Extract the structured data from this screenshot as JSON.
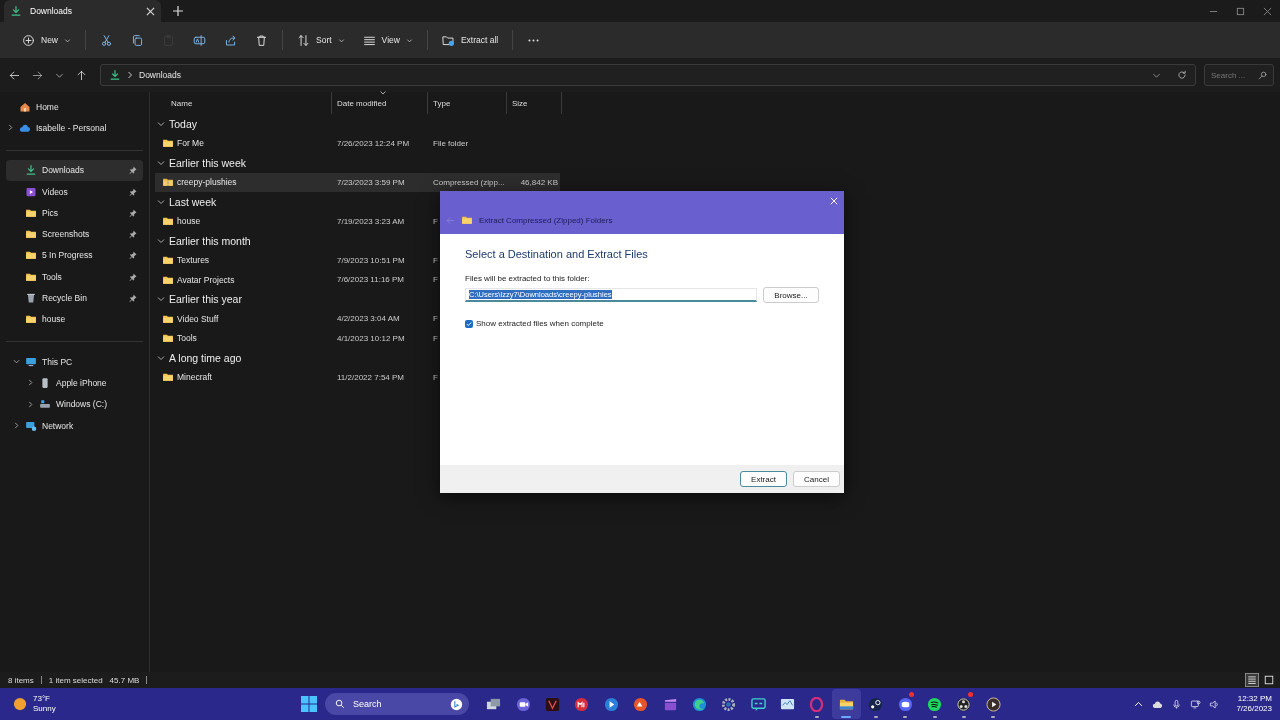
{
  "window": {
    "tab": {
      "title": "Downloads",
      "selected": true
    }
  },
  "toolbar": {
    "groups": [
      {
        "items": [
          {
            "kind": "new",
            "label": "New",
            "menu": true,
            "disabled": false
          }
        ]
      },
      {
        "items": [
          {
            "kind": "cut",
            "disabled": false
          },
          {
            "kind": "copy",
            "disabled": false
          },
          {
            "kind": "paste",
            "disabled": true
          },
          {
            "kind": "rename",
            "disabled": false
          },
          {
            "kind": "share",
            "disabled": false
          },
          {
            "kind": "delete",
            "disabled": false
          }
        ]
      },
      {
        "items": [
          {
            "kind": "sort",
            "label": "Sort",
            "menu": true,
            "disabled": false
          },
          {
            "kind": "view",
            "label": "View",
            "menu": true,
            "disabled": false
          }
        ]
      },
      {
        "items": [
          {
            "kind": "extract",
            "label": "Extract all",
            "menu": false,
            "disabled": false
          }
        ]
      },
      {
        "items": [
          {
            "kind": "more",
            "disabled": false
          }
        ]
      }
    ]
  },
  "address": {
    "path": [
      "Downloads"
    ],
    "search_placeholder": "Search ..."
  },
  "sidebar": {
    "sections": [
      {
        "items": [
          {
            "label": "Home",
            "kind": "home",
            "pinned": false,
            "selected": false
          },
          {
            "label": "Isabelle - Personal",
            "kind": "cloud",
            "pinned": false,
            "selected": false,
            "expanded": false
          }
        ]
      },
      {
        "items": [
          {
            "label": "Downloads",
            "kind": "download",
            "pinned": true,
            "selected": true
          },
          {
            "label": "Videos",
            "kind": "video",
            "pinned": true,
            "selected": false
          },
          {
            "label": "Pics",
            "kind": "folder",
            "pinned": true,
            "selected": false
          },
          {
            "label": "Screenshots",
            "kind": "folder",
            "pinned": true,
            "selected": false
          },
          {
            "label": "5 In Progress",
            "kind": "folder",
            "pinned": true,
            "selected": false
          },
          {
            "label": "Tools",
            "kind": "folder",
            "pinned": true,
            "selected": false
          },
          {
            "label": "Recycle Bin",
            "kind": "bin",
            "pinned": true,
            "selected": false
          },
          {
            "label": "house",
            "kind": "folder",
            "pinned": false,
            "selected": false
          }
        ]
      },
      {
        "items": [
          {
            "label": "This PC",
            "kind": "pc",
            "pinned": false,
            "selected": false,
            "expanded": true,
            "children": [
              {
                "label": "Apple iPhone",
                "kind": "phone",
                "pinned": false,
                "selected": false,
                "expanded": false
              },
              {
                "label": "Windows (C:)",
                "kind": "drive",
                "pinned": false,
                "selected": false,
                "expanded": false
              }
            ]
          },
          {
            "label": "Network",
            "kind": "network",
            "pinned": false,
            "selected": false,
            "expanded": false
          }
        ]
      }
    ]
  },
  "file_list": {
    "columns": [
      {
        "label": "Name",
        "sorted": false
      },
      {
        "label": "Date modified",
        "sorted": true
      },
      {
        "label": "Type",
        "sorted": false
      },
      {
        "label": "Size",
        "sorted": false
      }
    ],
    "groups": [
      {
        "label": "Today",
        "expanded": true,
        "rows": [
          {
            "name": "For Me",
            "kind": "folder",
            "date": "7/26/2023 12:24 PM",
            "type": "File folder",
            "selected": false
          }
        ]
      },
      {
        "label": "Earlier this week",
        "expanded": true,
        "rows": [
          {
            "name": "creepy-plushies",
            "kind": "zip",
            "date": "7/23/2023 3:59 PM",
            "type": "Compressed (zipp...",
            "size": "46,842 KB",
            "selected": true
          }
        ]
      },
      {
        "label": "Last week",
        "expanded": true,
        "rows": [
          {
            "name": "house",
            "kind": "folder",
            "date": "7/19/2023 3:23 AM",
            "type": "F",
            "selected": false
          }
        ]
      },
      {
        "label": "Earlier this month",
        "expanded": true,
        "rows": [
          {
            "name": "Textures",
            "kind": "folder",
            "date": "7/9/2023 10:51 PM",
            "type": "F",
            "selected": false
          },
          {
            "name": "Avatar Projects",
            "kind": "folder",
            "date": "7/6/2023 11:16 PM",
            "type": "F",
            "selected": false
          }
        ]
      },
      {
        "label": "Earlier this year",
        "expanded": true,
        "rows": [
          {
            "name": "Video Stuff",
            "kind": "folder",
            "date": "4/2/2023 3:04 AM",
            "type": "F",
            "selected": false
          },
          {
            "name": "Tools",
            "kind": "folder",
            "date": "4/1/2023 10:12 PM",
            "type": "F",
            "selected": false
          }
        ]
      },
      {
        "label": "A long time ago",
        "expanded": true,
        "rows": [
          {
            "name": "Minecraft",
            "kind": "folder",
            "date": "11/2/2022 7:54 PM",
            "type": "F",
            "selected": false
          }
        ]
      }
    ]
  },
  "status": {
    "count": "8 items",
    "selection": "1 item selected",
    "size": "45.7 MB",
    "views": [
      {
        "kind": "details",
        "selected": true
      },
      {
        "kind": "tiles",
        "selected": false
      }
    ]
  },
  "dialog": {
    "title": "Extract Compressed (Zipped) Folders",
    "heading": "Select a Destination and Extract Files",
    "field_label": "Files will be extracted to this folder:",
    "path": "C:\\Users\\Izzy7\\Downloads\\creepy-plushies",
    "browse": "Browse...",
    "checkbox": {
      "label": "Show extracted files when complete",
      "checked": true
    },
    "buttons": [
      {
        "label": "Extract",
        "default": true
      },
      {
        "label": "Cancel",
        "default": false
      }
    ]
  },
  "taskbar": {
    "weather": {
      "temp": "73°F",
      "condition": "Sunny"
    },
    "search": "Search",
    "apps": [
      {
        "kind": "taskview",
        "open": false,
        "focused": false
      },
      {
        "kind": "camera",
        "open": false,
        "focused": false
      },
      {
        "kind": "tile",
        "open": false,
        "focused": false
      },
      {
        "kind": "redcircle",
        "open": false,
        "focused": false
      },
      {
        "kind": "bluecircle",
        "open": false,
        "focused": false
      },
      {
        "kind": "orangecircle",
        "open": false,
        "focused": false
      },
      {
        "kind": "clapper",
        "open": false,
        "focused": false
      },
      {
        "kind": "globe",
        "open": false,
        "focused": false
      },
      {
        "kind": "gear",
        "open": false,
        "focused": false
      },
      {
        "kind": "caption",
        "open": false,
        "focused": false
      },
      {
        "kind": "monitor",
        "open": false,
        "focused": false
      },
      {
        "kind": "ring",
        "open": true,
        "focused": false
      },
      {
        "kind": "folder",
        "open": true,
        "focused": true
      },
      {
        "kind": "disc",
        "open": true,
        "focused": false
      },
      {
        "kind": "chat",
        "open": true,
        "focused": false,
        "badge": true
      },
      {
        "kind": "waves",
        "open": true,
        "focused": false
      },
      {
        "kind": "aperture",
        "open": true,
        "focused": false,
        "badge": true
      },
      {
        "kind": "play",
        "open": true,
        "focused": false
      }
    ],
    "tray": [
      {
        "kind": "chevron"
      },
      {
        "kind": "cloud"
      },
      {
        "kind": "mic"
      },
      {
        "kind": "network"
      },
      {
        "kind": "volume"
      }
    ],
    "time": "12:32 PM",
    "date": "7/26/2023"
  }
}
